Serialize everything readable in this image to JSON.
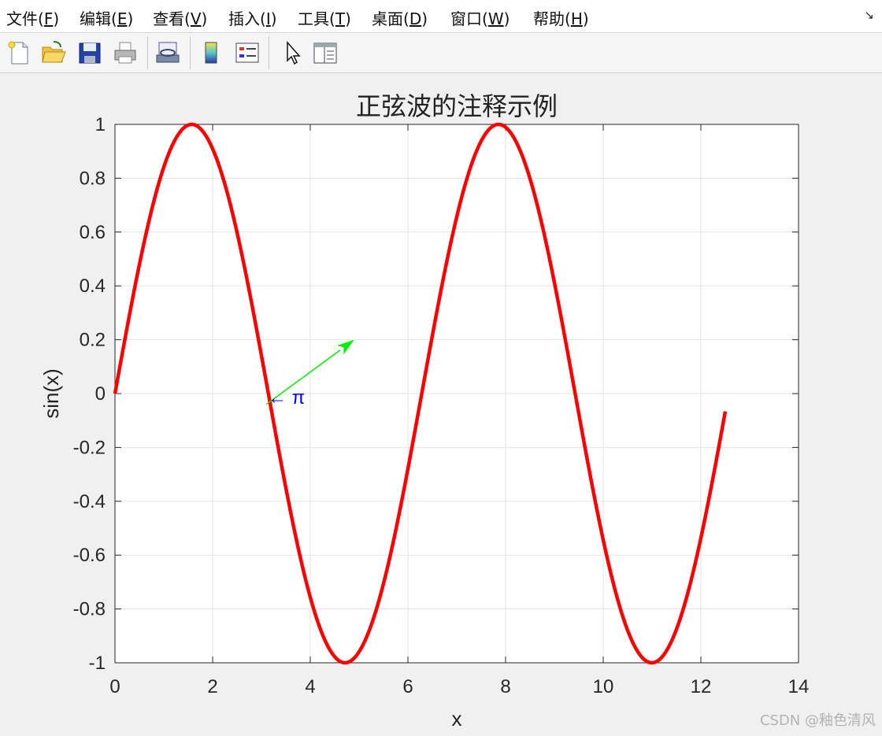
{
  "menu": [
    {
      "text": "文件(",
      "key": "F",
      "close": ")"
    },
    {
      "text": "编辑(",
      "key": "E",
      "close": ")"
    },
    {
      "text": "查看(",
      "key": "V",
      "close": ")"
    },
    {
      "text": "插入(",
      "key": "I",
      "close": ")"
    },
    {
      "text": "工具(",
      "key": "T",
      "close": ")"
    },
    {
      "text": "桌面(",
      "key": "D",
      "close": ")"
    },
    {
      "text": "窗口(",
      "key": "W",
      "close": ")"
    },
    {
      "text": "帮助(",
      "key": "H",
      "close": ")"
    }
  ],
  "menu_corner_icon": "dock-arrow-icon",
  "toolbar": [
    "new-figure-icon",
    "open-file-icon",
    "save-icon",
    "print-icon",
    "link-plot-icon",
    "insert-colorbar-icon",
    "insert-legend-icon",
    "edit-plot-pointer-icon",
    "property-inspector-icon"
  ],
  "watermark": "CSDN @釉色清风",
  "annotation": {
    "text": "← π",
    "color": "#0000ff"
  },
  "chart_data": {
    "type": "line",
    "title": "正弦波的注释示例",
    "xlabel": "x",
    "ylabel": "sin(x)",
    "xlim": [
      0,
      14
    ],
    "ylim": [
      -1,
      1
    ],
    "xticks": [
      0,
      2,
      4,
      6,
      8,
      10,
      12,
      14
    ],
    "yticks": [
      1,
      0.8,
      0.6,
      0.4,
      0.2,
      0,
      -0.2,
      -0.4,
      -0.6,
      -0.8,
      -1
    ],
    "grid": true,
    "series": [
      {
        "function": "sin(x)",
        "x_range": [
          0,
          12.5
        ],
        "color": "#ff0000"
      }
    ],
    "arrow": {
      "from": [
        3.1,
        -0.04
      ],
      "to": [
        4.9,
        0.2
      ],
      "color": "#00ee00"
    }
  }
}
